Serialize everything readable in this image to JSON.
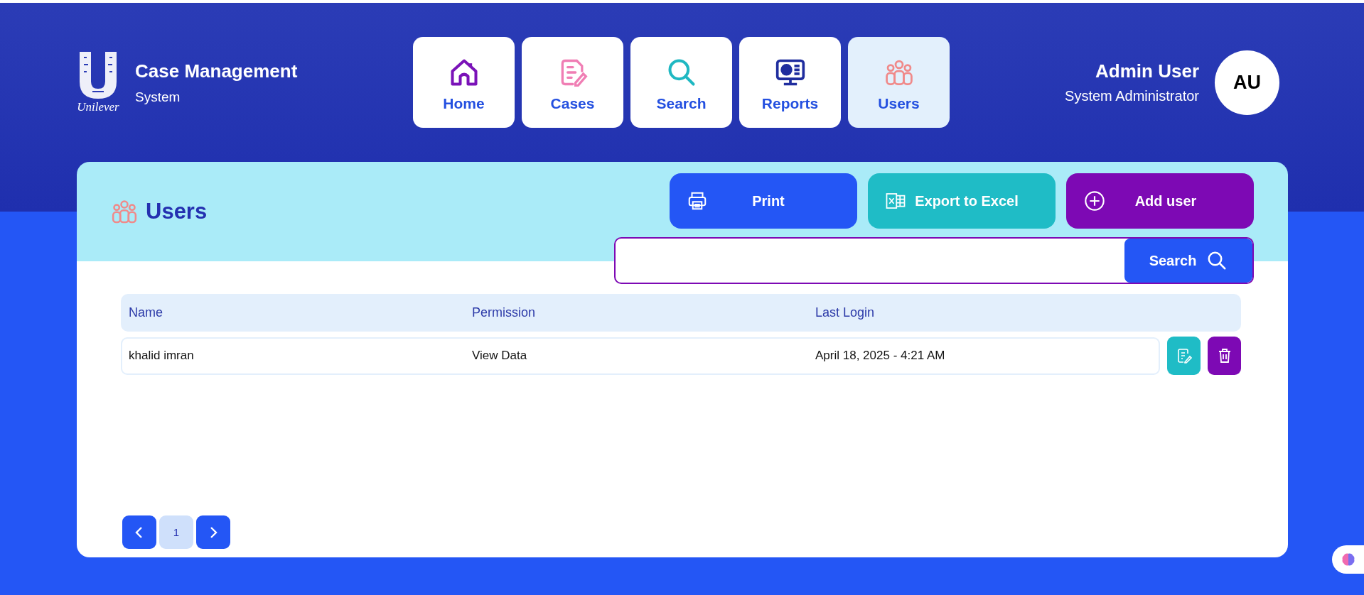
{
  "brand": {
    "logo_text": "Unilever",
    "title": "Case Management",
    "subtitle": "System"
  },
  "nav": [
    {
      "label": "Home",
      "selected": false
    },
    {
      "label": "Cases",
      "selected": false
    },
    {
      "label": "Search",
      "selected": false
    },
    {
      "label": "Reports",
      "selected": false
    },
    {
      "label": "Users",
      "selected": true
    }
  ],
  "user": {
    "name": "Admin User",
    "role": "System Administrator",
    "initials": "AU"
  },
  "page": {
    "title": "Users"
  },
  "actions": [
    {
      "kind": "print",
      "label": "Print"
    },
    {
      "kind": "excel",
      "label": "Export to Excel"
    },
    {
      "kind": "add",
      "label": "Add user"
    }
  ],
  "search": {
    "button": "Search"
  },
  "table": {
    "columns": [
      "Name",
      "Permission",
      "Last Login"
    ],
    "rows": [
      {
        "cells": [
          "khalid imran",
          "View Data",
          "April 18, 2025 - 4:21 AM"
        ]
      }
    ]
  },
  "pagination": {
    "pages": [
      {
        "label": "1",
        "selected": true
      }
    ]
  }
}
